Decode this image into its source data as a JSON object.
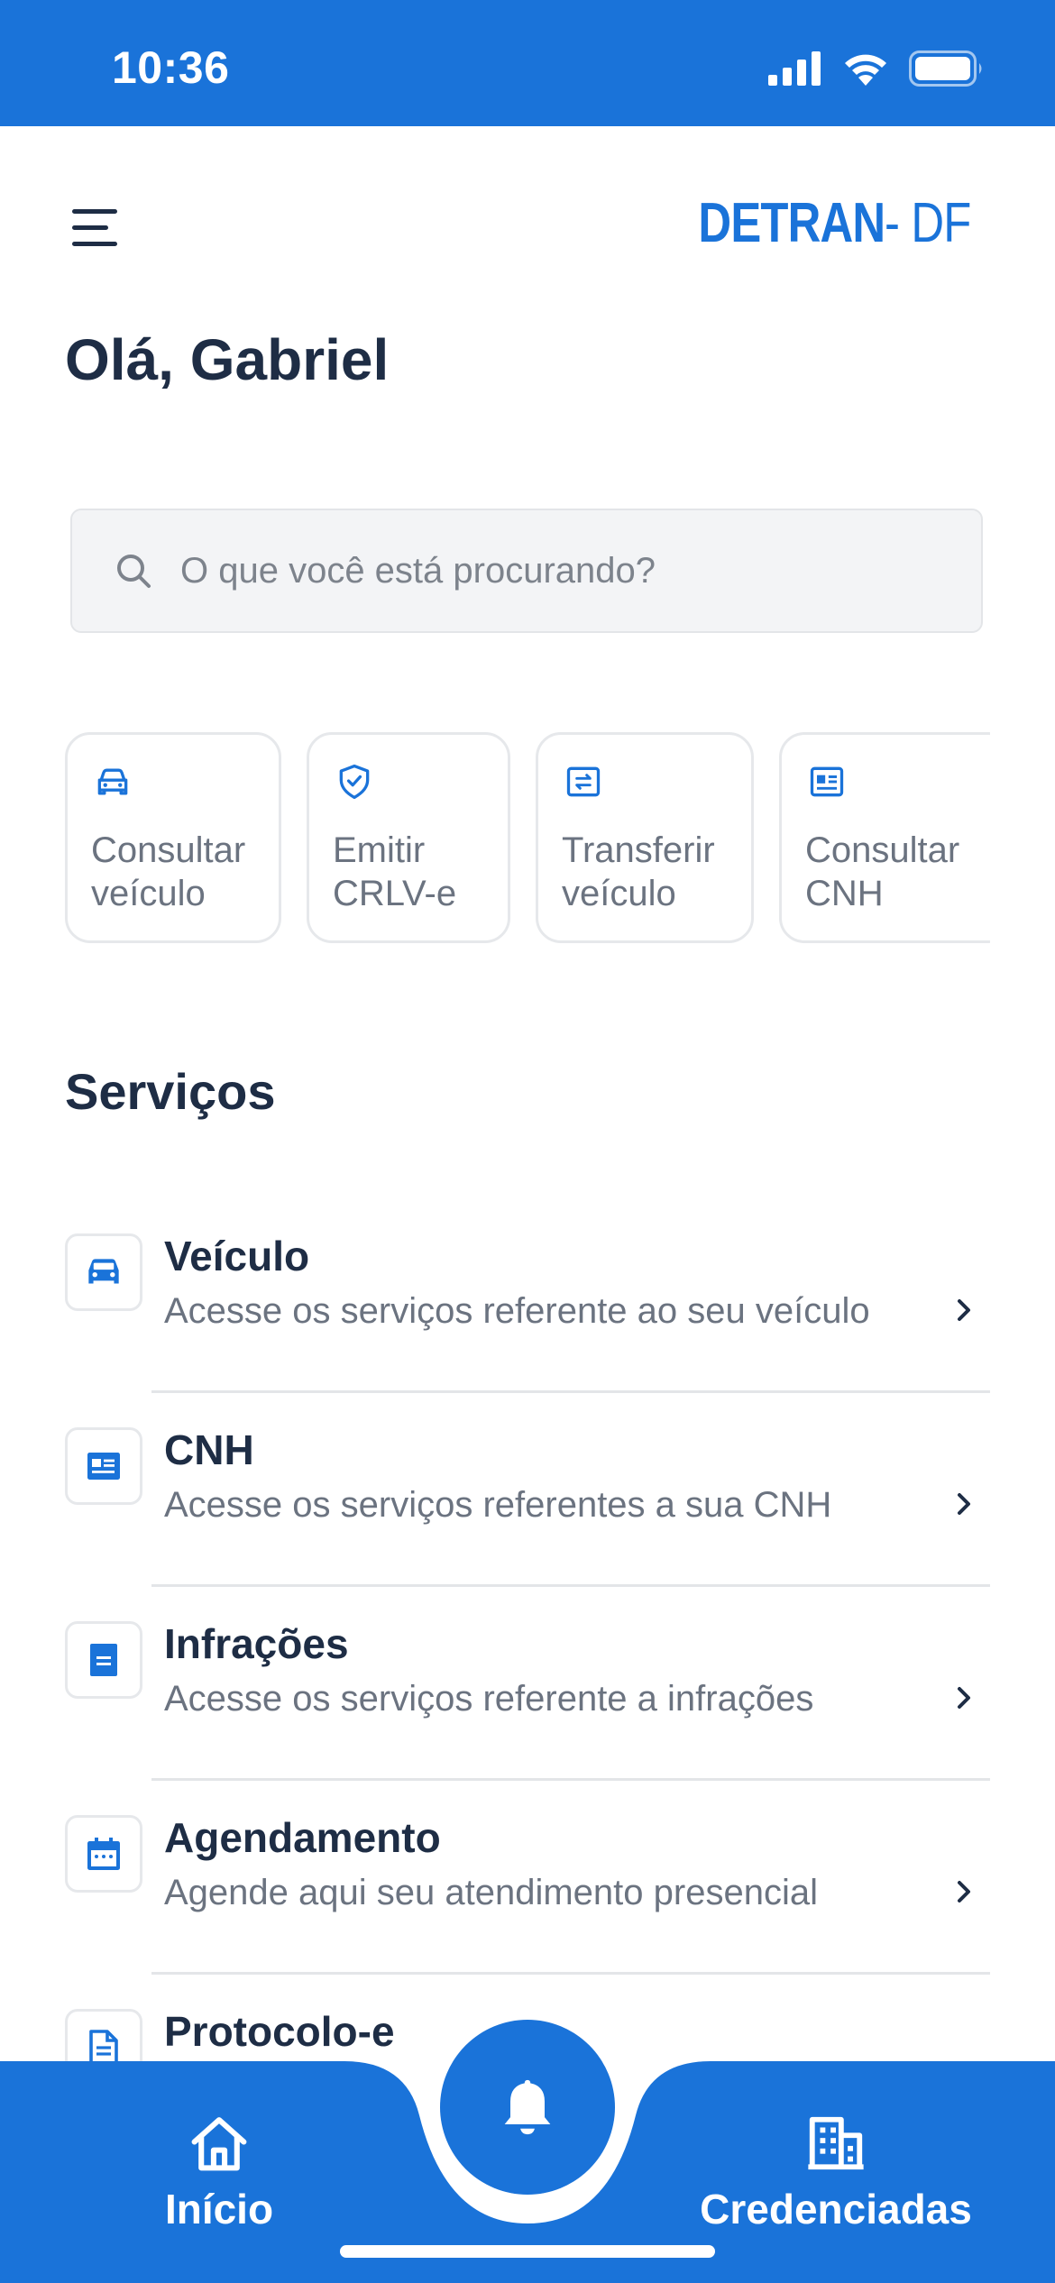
{
  "status_bar": {
    "time": "10:36"
  },
  "header": {
    "brand_main": "DETRAN",
    "brand_suffix": " - DF",
    "greeting": "Olá, Gabriel"
  },
  "search": {
    "placeholder": "O que você está procurando?"
  },
  "quick_actions": [
    {
      "label": "Consultar\nveículo",
      "icon": "car-icon"
    },
    {
      "label": "Emitir\nCRLV-e",
      "icon": "shield-check-icon"
    },
    {
      "label": "Transferir\nveículo",
      "icon": "transfer-icon"
    },
    {
      "label": "Consultar\nCNH",
      "icon": "id-card-icon"
    }
  ],
  "services": {
    "title": "Serviços",
    "items": [
      {
        "title": "Veículo",
        "description": "Acesse os serviços referente ao seu veículo",
        "icon": "car-icon"
      },
      {
        "title": "CNH",
        "description": "Acesse os serviços referentes a sua CNH",
        "icon": "id-card-icon"
      },
      {
        "title": "Infrações",
        "description": "Acesse os serviços referente a infrações",
        "icon": "document-icon"
      },
      {
        "title": "Agendamento",
        "description": "Agende aqui seu atendimento presencial",
        "icon": "calendar-icon"
      },
      {
        "title": "Protocolo-e",
        "description": "",
        "icon": "file-text-icon"
      }
    ]
  },
  "bottom_nav": {
    "home_label": "Início",
    "credenciadas_label": "Credenciadas"
  },
  "colors": {
    "primary": "#1a73d9",
    "text_dark": "#1e2d45",
    "text_muted": "#6b7380"
  }
}
